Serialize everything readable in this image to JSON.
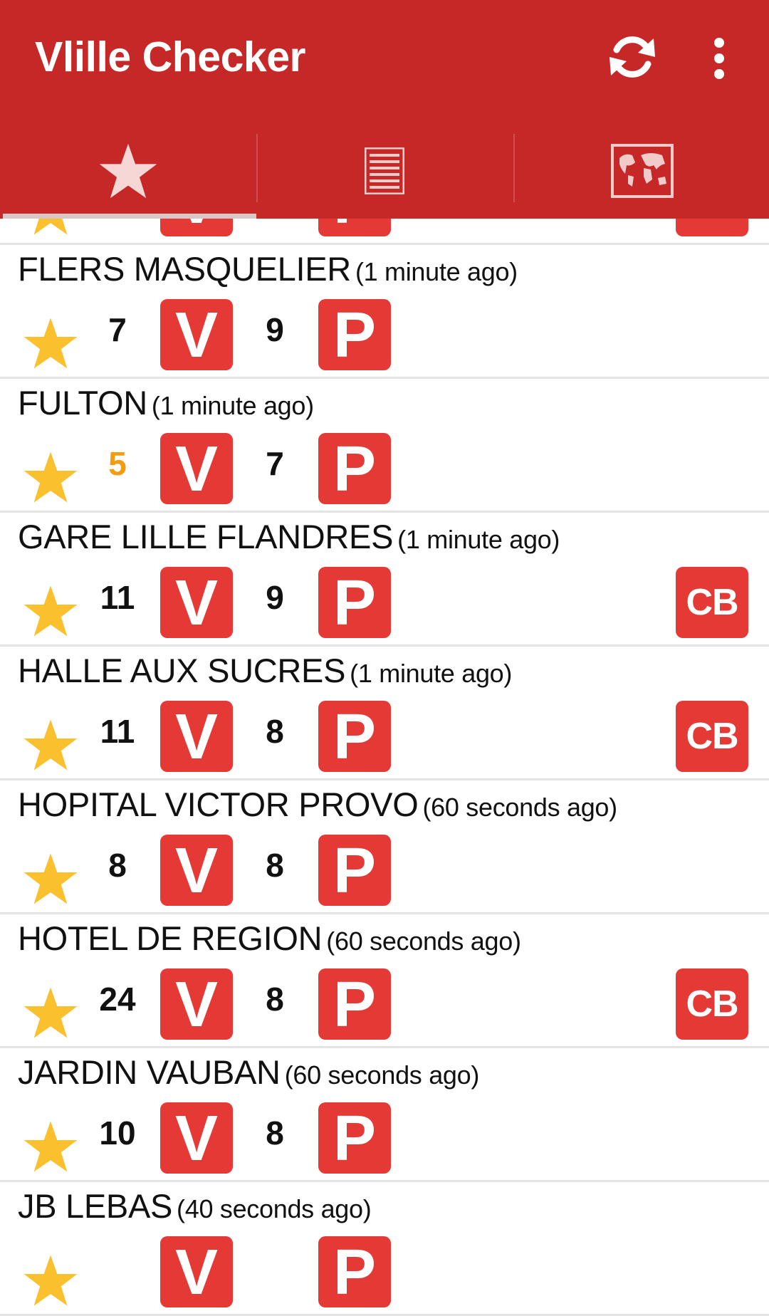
{
  "app": {
    "title": "Vlille Checker"
  },
  "toolbar": {
    "refresh_icon": "refresh-icon",
    "overflow_icon": "more-vert-icon"
  },
  "tabs": [
    {
      "icon": "star-icon",
      "selected": true
    },
    {
      "icon": "list-icon",
      "selected": false
    },
    {
      "icon": "world-map-icon",
      "selected": false
    }
  ],
  "colors": {
    "primary": "#c62828",
    "badge": "#e53935",
    "star": "#fbc02d",
    "low_count": "#f39c12"
  },
  "stations": [
    {
      "name": "",
      "ago": "",
      "bikes": "",
      "slots": "",
      "cb": true,
      "partial": true
    },
    {
      "name": "FLERS MASQUELIER",
      "ago": "(1 minute ago)",
      "bikes": "7",
      "slots": "9",
      "cb": false,
      "low": false
    },
    {
      "name": "FULTON",
      "ago": "(1 minute ago)",
      "bikes": "5",
      "slots": "7",
      "cb": false,
      "low": true
    },
    {
      "name": "GARE LILLE FLANDRES",
      "ago": "(1 minute ago)",
      "bikes": "11",
      "slots": "9",
      "cb": true,
      "low": false
    },
    {
      "name": "HALLE AUX SUCRES",
      "ago": "(1 minute ago)",
      "bikes": "11",
      "slots": "8",
      "cb": true,
      "low": false
    },
    {
      "name": "HOPITAL VICTOR PROVO",
      "ago": "(60 seconds ago)",
      "bikes": "8",
      "slots": "8",
      "cb": false,
      "low": false
    },
    {
      "name": "HOTEL DE REGION",
      "ago": "(60 seconds ago)",
      "bikes": "24",
      "slots": "8",
      "cb": true,
      "low": false
    },
    {
      "name": "JARDIN VAUBAN",
      "ago": "(60 seconds ago)",
      "bikes": "10",
      "slots": "8",
      "cb": false,
      "low": false
    },
    {
      "name": "JB LEBAS",
      "ago": "(40 seconds ago)",
      "bikes": "",
      "slots": "",
      "cb": false,
      "partial": true
    }
  ],
  "badges": {
    "v": "V",
    "p": "P",
    "cb": "CB"
  }
}
